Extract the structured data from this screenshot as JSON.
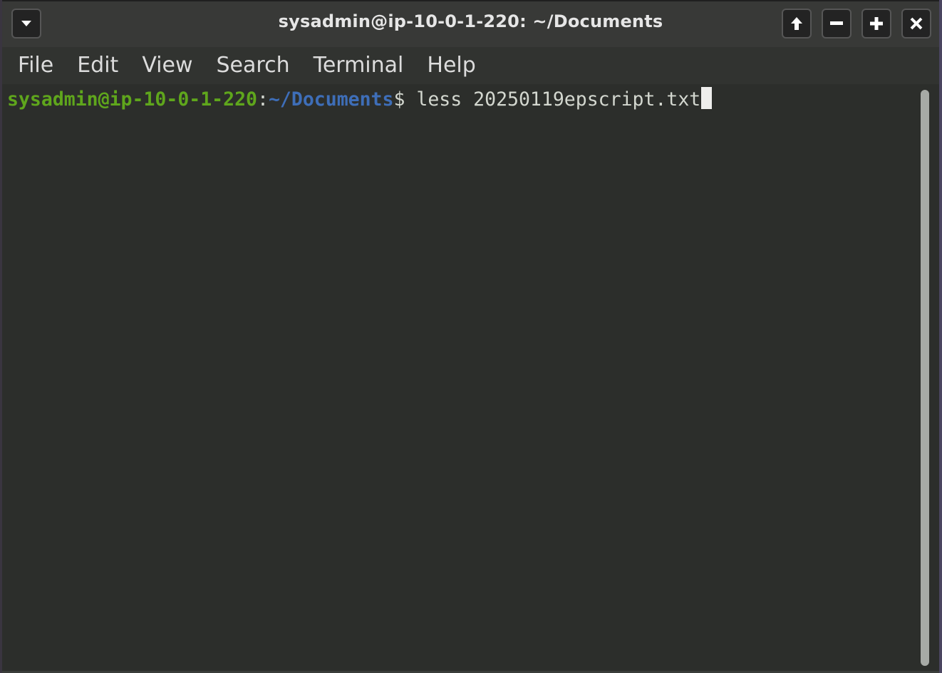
{
  "window": {
    "title": "sysadmin@ip-10-0-1-220: ~/Documents",
    "buttons": {
      "menu": "menu-dropdown",
      "up": "raise-window",
      "minimize": "minimize",
      "maximize": "maximize",
      "close": "close"
    }
  },
  "menubar": {
    "items": [
      {
        "label": "File"
      },
      {
        "label": "Edit"
      },
      {
        "label": "View"
      },
      {
        "label": "Search"
      },
      {
        "label": "Terminal"
      },
      {
        "label": "Help"
      }
    ]
  },
  "terminal": {
    "prompt": {
      "user_host": "sysadmin@ip-10-0-1-220",
      "separator": ":",
      "path": "~/Documents",
      "symbol": "$"
    },
    "command": " less 20250119epscript.txt",
    "colors": {
      "user_host": "#5fa61c",
      "path": "#3e6eb8",
      "text": "#d3d7cf",
      "background": "#2c2e2b"
    }
  }
}
